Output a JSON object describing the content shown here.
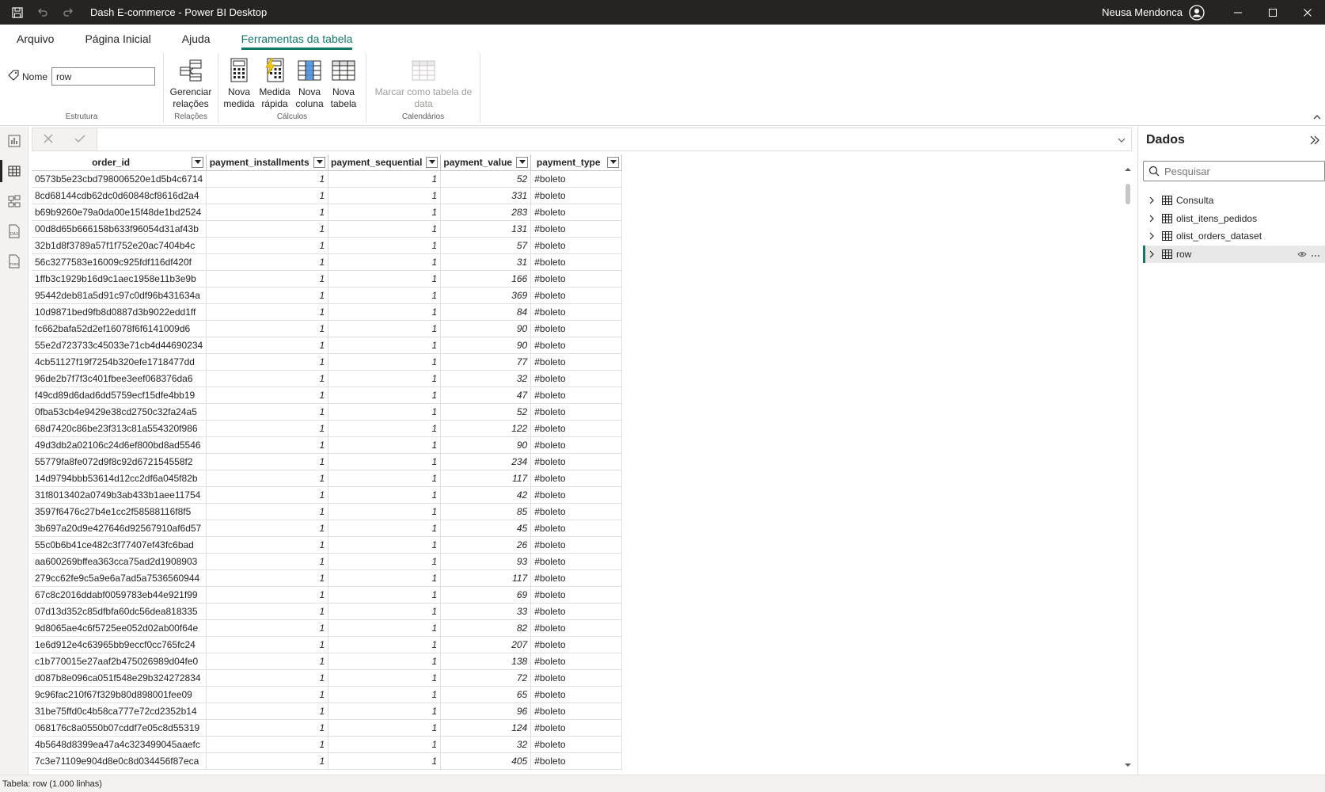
{
  "titlebar": {
    "title": "Dash E-commerce - Power BI Desktop",
    "user": "Neusa Mendonca"
  },
  "menu": {
    "tabs": [
      {
        "label": "Arquivo"
      },
      {
        "label": "Página Inicial"
      },
      {
        "label": "Ajuda"
      },
      {
        "label": "Ferramentas da tabela"
      }
    ],
    "active_tab": "Ferramentas da tabela"
  },
  "ribbon": {
    "name_label": "Nome",
    "name_value": "row",
    "groups": {
      "estrutura": "Estrutura",
      "relacoes": "Relações",
      "calculos": "Cálculos",
      "calendarios": "Calendários"
    },
    "buttons": {
      "gerenciar": [
        "Gerenciar",
        "relações"
      ],
      "nova_medida": [
        "Nova",
        "medida"
      ],
      "medida_rapida": [
        "Medida",
        "rápida"
      ],
      "nova_coluna": [
        "Nova",
        "coluna"
      ],
      "nova_tabela": [
        "Nova",
        "tabela"
      ],
      "marcar": [
        "Marcar como tabela de",
        "data"
      ]
    }
  },
  "grid": {
    "columns": [
      "order_id",
      "payment_installments",
      "payment_sequential",
      "payment_value",
      "payment_type"
    ],
    "rows": [
      [
        "0573b5e23cbd798006520e1d5b4c6714",
        "1",
        "1",
        "52",
        "#boleto"
      ],
      [
        "8cd68144cdb62dc0d60848cf8616d2a4",
        "1",
        "1",
        "331",
        "#boleto"
      ],
      [
        "b69b9260e79a0da00e15f48de1bd2524",
        "1",
        "1",
        "283",
        "#boleto"
      ],
      [
        "00d8d65b666158b633f96054d31af43b",
        "1",
        "1",
        "131",
        "#boleto"
      ],
      [
        "32b1d8f3789a57f1f752e20ac7404b4c",
        "1",
        "1",
        "57",
        "#boleto"
      ],
      [
        "56c3277583e16009c925fdf116df420f",
        "1",
        "1",
        "31",
        "#boleto"
      ],
      [
        "1ffb3c1929b16d9c1aec1958e11b3e9b",
        "1",
        "1",
        "166",
        "#boleto"
      ],
      [
        "95442deb81a5d91c97c0df96b431634a",
        "1",
        "1",
        "369",
        "#boleto"
      ],
      [
        "10d9871bed9fb8d0887d3b9022edd1ff",
        "1",
        "1",
        "84",
        "#boleto"
      ],
      [
        "fc662bafa52d2ef16078f6f6141009d6",
        "1",
        "1",
        "90",
        "#boleto"
      ],
      [
        "55e2d723733c45033e71cb4d44690234",
        "1",
        "1",
        "90",
        "#boleto"
      ],
      [
        "4cb51127f19f7254b320efe1718477dd",
        "1",
        "1",
        "77",
        "#boleto"
      ],
      [
        "96de2b7f7f3c401fbee3eef068376da6",
        "1",
        "1",
        "32",
        "#boleto"
      ],
      [
        "f49cd89d6dad6dd5759ecf15dfe4bb19",
        "1",
        "1",
        "47",
        "#boleto"
      ],
      [
        "0fba53cb4e9429e38cd2750c32fa24a5",
        "1",
        "1",
        "52",
        "#boleto"
      ],
      [
        "68d7420c86be23f313c81a554320f986",
        "1",
        "1",
        "122",
        "#boleto"
      ],
      [
        "49d3db2a02106c24d6ef800bd8ad5546",
        "1",
        "1",
        "90",
        "#boleto"
      ],
      [
        "55779fa8fe072d9f8c92d672154558f2",
        "1",
        "1",
        "234",
        "#boleto"
      ],
      [
        "14d9794bbb53614d12cc2df6a045f82b",
        "1",
        "1",
        "117",
        "#boleto"
      ],
      [
        "31f8013402a0749b3ab433b1aee11754",
        "1",
        "1",
        "42",
        "#boleto"
      ],
      [
        "3597f6476c27b4e1cc2f58588116f8f5",
        "1",
        "1",
        "85",
        "#boleto"
      ],
      [
        "3b697a20d9e427646d92567910af6d57",
        "1",
        "1",
        "45",
        "#boleto"
      ],
      [
        "55c0b6b41ce482c3f77407ef43fc6bad",
        "1",
        "1",
        "26",
        "#boleto"
      ],
      [
        "aa600269bffea363cca75ad2d1908903",
        "1",
        "1",
        "93",
        "#boleto"
      ],
      [
        "279cc62fe9c5a9e6a7ad5a7536560944",
        "1",
        "1",
        "117",
        "#boleto"
      ],
      [
        "67c8c2016ddabf0059783eb44e921f99",
        "1",
        "1",
        "69",
        "#boleto"
      ],
      [
        "07d13d352c85dfbfa60dc56dea818335",
        "1",
        "1",
        "33",
        "#boleto"
      ],
      [
        "9d8065ae4c6f5725ee052d02ab00f64e",
        "1",
        "1",
        "82",
        "#boleto"
      ],
      [
        "1e6d912e4c63965bb9eccf0cc765fc24",
        "1",
        "1",
        "207",
        "#boleto"
      ],
      [
        "c1b770015e27aaf2b475026989d04fe0",
        "1",
        "1",
        "138",
        "#boleto"
      ],
      [
        "d087b8e096ca051f548e29b324272834",
        "1",
        "1",
        "72",
        "#boleto"
      ],
      [
        "9c96fac210f67f329b80d898001fee09",
        "1",
        "1",
        "65",
        "#boleto"
      ],
      [
        "31be75ffd0c4b58ca777e72cd2352b14",
        "1",
        "1",
        "96",
        "#boleto"
      ],
      [
        "068176c8a0550b07cddf7e05c8d55319",
        "1",
        "1",
        "124",
        "#boleto"
      ],
      [
        "4b5648d8399ea47a4c323499045aaefc",
        "1",
        "1",
        "32",
        "#boleto"
      ],
      [
        "7c3e71109e904d8e0c8d034456f87eca",
        "1",
        "1",
        "405",
        "#boleto"
      ]
    ]
  },
  "datapane": {
    "title": "Dados",
    "search_placeholder": "Pesquisar",
    "items": [
      "Consulta",
      "olist_itens_pedidos",
      "olist_orders_dataset",
      "row"
    ],
    "selected_item": "row"
  },
  "statusbar": {
    "text": "Tabela: row (1.000 linhas)"
  },
  "colors": {
    "accent": "#117865",
    "titlebar": "#252423"
  }
}
